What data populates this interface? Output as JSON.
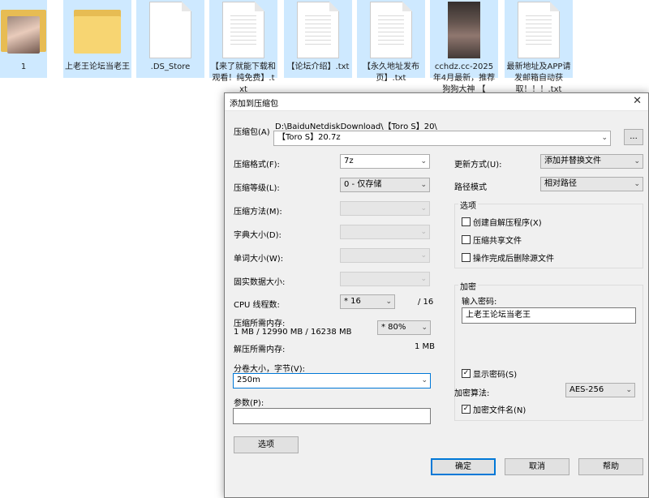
{
  "desktop": {
    "files": [
      {
        "label": "1",
        "kind": "folder-photo"
      },
      {
        "label": "上老王论坛当老王",
        "kind": "folder"
      },
      {
        "label": ".DS_Store",
        "kind": "doc"
      },
      {
        "label": "【来了就能下载和观看！纯免费】.txt",
        "kind": "doc"
      },
      {
        "label": "【论坛介绍】.txt",
        "kind": "doc"
      },
      {
        "label": "【永久地址发布页】.txt",
        "kind": "doc"
      },
      {
        "label": "cchdz.cc-2025年4月最新，推荐狗狗大神 【",
        "kind": "photo"
      },
      {
        "label": "最新地址及APP请发邮箱自动获取！！！.txt",
        "kind": "doc"
      }
    ]
  },
  "dialog": {
    "title": "添加到压缩包",
    "close_glyph": "✕",
    "archive": {
      "label": "压缩包(A)",
      "path": "D:\\BaiduNetdiskDownload\\【Toro S】20\\",
      "name": "【Toro S】20.7z",
      "browse_label": "..."
    },
    "left": {
      "format": {
        "label": "压缩格式(F):",
        "value": "7z"
      },
      "level": {
        "label": "压缩等级(L):",
        "value": "0 - 仅存储"
      },
      "method": {
        "label": "压缩方法(M):",
        "value": ""
      },
      "dict": {
        "label": "字典大小(D):",
        "value": ""
      },
      "word": {
        "label": "单词大小(W):",
        "value": ""
      },
      "solid": {
        "label": "固实数据大小:",
        "value": ""
      },
      "cpu": {
        "label": "CPU 线程数:",
        "value": "* 16",
        "total": "/ 16"
      },
      "mem_compress": {
        "label": "压缩所需内存:",
        "detail": "1 MB / 12990 MB / 16238 MB",
        "percent": "* 80%"
      },
      "mem_decompress": {
        "label": "解压所需内存:",
        "value": "1 MB"
      },
      "volume": {
        "label": "分卷大小，字节(V):",
        "value": "250m"
      },
      "params": {
        "label": "参数(P):",
        "value": ""
      },
      "options_button": "选项"
    },
    "right": {
      "update": {
        "label": "更新方式(U):",
        "value": "添加并替换文件"
      },
      "pathmode": {
        "label": "路径模式",
        "value": "相对路径"
      },
      "options": {
        "title": "选项",
        "items": [
          {
            "label": "创建自解压程序(X)",
            "checked": false
          },
          {
            "label": "压缩共享文件",
            "checked": false
          },
          {
            "label": "操作完成后删除源文件",
            "checked": false
          }
        ]
      },
      "encryption": {
        "title": "加密",
        "password_label": "输入密码:",
        "password_value": "上老王论坛当老王",
        "show_password": {
          "label": "显示密码(S)",
          "checked": true
        },
        "method_label": "加密算法:",
        "method_value": "AES-256",
        "encrypt_names": {
          "label": "加密文件名(N)",
          "checked": true
        }
      }
    },
    "buttons": {
      "ok": "确定",
      "cancel": "取消",
      "help": "帮助"
    },
    "check_glyph": "✓",
    "arrow_glyph": "⌄"
  }
}
